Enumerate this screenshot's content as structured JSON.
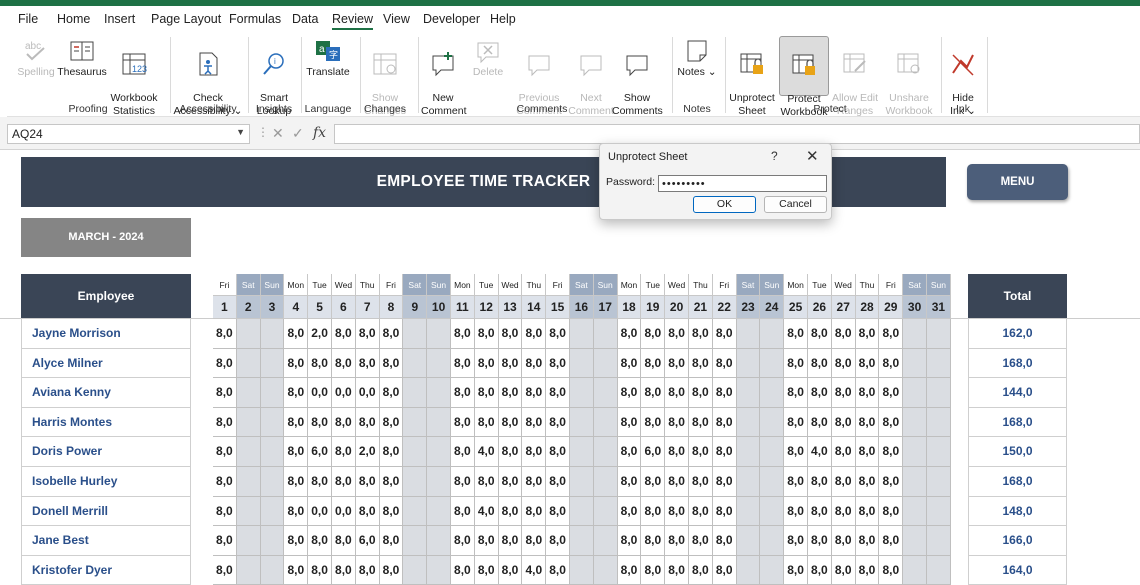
{
  "menu_tabs": [
    "File",
    "Home",
    "Insert",
    "Page Layout",
    "Formulas",
    "Data",
    "Review",
    "View",
    "Developer",
    "Help"
  ],
  "active_tab": "Review",
  "ribbon": {
    "spelling": "Spelling",
    "thesaurus": "Thesaurus",
    "workbook_statistics": "Workbook\nStatistics",
    "proofing": "Proofing",
    "check_accessibility": "Check\nAccessibility ⌄",
    "accessibility": "Accessibility",
    "smart_lookup": "Smart\nLookup",
    "insights": "Insights",
    "translate": "Translate",
    "language": "Language",
    "show_changes": "Show\nChanges",
    "changes": "Changes",
    "new_comment": "New\nComment",
    "delete": "Delete",
    "previous_comment": "Previous\nComment",
    "next_comment": "Next\nComment",
    "show_comments": "Show\nComments",
    "comments": "Comments",
    "notes": "Notes ⌄",
    "notes_group": "Notes",
    "unprotect_sheet": "Unprotect\nSheet",
    "protect_workbook": "Protect\nWorkbook",
    "allow_edit_ranges": "Allow Edit\nRanges",
    "unshare_workbook": "Unshare\nWorkbook",
    "protect": "Protect",
    "hide_ink": "Hide\nInk ⌄",
    "ink": "Ink"
  },
  "formula_bar": {
    "name_box": "AQ24",
    "fx": "fx"
  },
  "sheet": {
    "title": "EMPLOYEE TIME TRACKER",
    "menu_button": "MENU",
    "month": "MARCH - 2024",
    "employee_header": "Employee",
    "total_header": "Total",
    "day_names": [
      "Fri",
      "Sat",
      "Sun",
      "Mon",
      "Tue",
      "Wed",
      "Thu",
      "Fri",
      "Sat",
      "Sun",
      "Mon",
      "Tue",
      "Wed",
      "Thu",
      "Fri",
      "Sat",
      "Sun",
      "Mon",
      "Tue",
      "Wed",
      "Thu",
      "Fri",
      "Sat",
      "Sun",
      "Mon",
      "Tue",
      "Wed",
      "Thu",
      "Fri",
      "Sat",
      "Sun"
    ],
    "day_numbers": [
      "1",
      "2",
      "3",
      "4",
      "5",
      "6",
      "7",
      "8",
      "9",
      "10",
      "11",
      "12",
      "13",
      "14",
      "15",
      "16",
      "17",
      "18",
      "19",
      "20",
      "21",
      "22",
      "23",
      "24",
      "25",
      "26",
      "27",
      "28",
      "29",
      "30",
      "31"
    ],
    "employees": [
      {
        "name": "Jayne Morrison",
        "hours": [
          "8,0",
          "",
          "",
          "8,0",
          "2,0",
          "8,0",
          "8,0",
          "8,0",
          "",
          "",
          "8,0",
          "8,0",
          "8,0",
          "8,0",
          "8,0",
          "",
          "",
          "8,0",
          "8,0",
          "8,0",
          "8,0",
          "8,0",
          "",
          "",
          "8,0",
          "8,0",
          "8,0",
          "8,0",
          "8,0",
          "",
          ""
        ],
        "total": "162,0"
      },
      {
        "name": "Alyce Milner",
        "hours": [
          "8,0",
          "",
          "",
          "8,0",
          "8,0",
          "8,0",
          "8,0",
          "8,0",
          "",
          "",
          "8,0",
          "8,0",
          "8,0",
          "8,0",
          "8,0",
          "",
          "",
          "8,0",
          "8,0",
          "8,0",
          "8,0",
          "8,0",
          "",
          "",
          "8,0",
          "8,0",
          "8,0",
          "8,0",
          "8,0",
          "",
          ""
        ],
        "total": "168,0"
      },
      {
        "name": "Aviana Kenny",
        "hours": [
          "8,0",
          "",
          "",
          "8,0",
          "0,0",
          "0,0",
          "0,0",
          "8,0",
          "",
          "",
          "8,0",
          "8,0",
          "8,0",
          "8,0",
          "8,0",
          "",
          "",
          "8,0",
          "8,0",
          "8,0",
          "8,0",
          "8,0",
          "",
          "",
          "8,0",
          "8,0",
          "8,0",
          "8,0",
          "8,0",
          "",
          ""
        ],
        "total": "144,0"
      },
      {
        "name": "Harris Montes",
        "hours": [
          "8,0",
          "",
          "",
          "8,0",
          "8,0",
          "8,0",
          "8,0",
          "8,0",
          "",
          "",
          "8,0",
          "8,0",
          "8,0",
          "8,0",
          "8,0",
          "",
          "",
          "8,0",
          "8,0",
          "8,0",
          "8,0",
          "8,0",
          "",
          "",
          "8,0",
          "8,0",
          "8,0",
          "8,0",
          "8,0",
          "",
          ""
        ],
        "total": "168,0"
      },
      {
        "name": "Doris Power",
        "hours": [
          "8,0",
          "",
          "",
          "8,0",
          "6,0",
          "8,0",
          "2,0",
          "8,0",
          "",
          "",
          "8,0",
          "4,0",
          "8,0",
          "8,0",
          "8,0",
          "",
          "",
          "8,0",
          "6,0",
          "8,0",
          "8,0",
          "8,0",
          "",
          "",
          "8,0",
          "4,0",
          "8,0",
          "8,0",
          "8,0",
          "",
          ""
        ],
        "total": "150,0"
      },
      {
        "name": "Isobelle Hurley",
        "hours": [
          "8,0",
          "",
          "",
          "8,0",
          "8,0",
          "8,0",
          "8,0",
          "8,0",
          "",
          "",
          "8,0",
          "8,0",
          "8,0",
          "8,0",
          "8,0",
          "",
          "",
          "8,0",
          "8,0",
          "8,0",
          "8,0",
          "8,0",
          "",
          "",
          "8,0",
          "8,0",
          "8,0",
          "8,0",
          "8,0",
          "",
          ""
        ],
        "total": "168,0"
      },
      {
        "name": "Donell Merrill",
        "hours": [
          "8,0",
          "",
          "",
          "8,0",
          "0,0",
          "0,0",
          "8,0",
          "8,0",
          "",
          "",
          "8,0",
          "4,0",
          "8,0",
          "8,0",
          "8,0",
          "",
          "",
          "8,0",
          "8,0",
          "8,0",
          "8,0",
          "8,0",
          "",
          "",
          "8,0",
          "8,0",
          "8,0",
          "8,0",
          "8,0",
          "",
          ""
        ],
        "total": "148,0"
      },
      {
        "name": "Jane Best",
        "hours": [
          "8,0",
          "",
          "",
          "8,0",
          "8,0",
          "8,0",
          "6,0",
          "8,0",
          "",
          "",
          "8,0",
          "8,0",
          "8,0",
          "8,0",
          "8,0",
          "",
          "",
          "8,0",
          "8,0",
          "8,0",
          "8,0",
          "8,0",
          "",
          "",
          "8,0",
          "8,0",
          "8,0",
          "8,0",
          "8,0",
          "",
          ""
        ],
        "total": "166,0"
      },
      {
        "name": "Kristofer Dyer",
        "hours": [
          "8,0",
          "",
          "",
          "8,0",
          "8,0",
          "8,0",
          "8,0",
          "8,0",
          "",
          "",
          "8,0",
          "8,0",
          "8,0",
          "4,0",
          "8,0",
          "",
          "",
          "8,0",
          "8,0",
          "8,0",
          "8,0",
          "8,0",
          "",
          "",
          "8,0",
          "8,0",
          "8,0",
          "8,0",
          "8,0",
          "",
          ""
        ],
        "total": "164,0"
      }
    ]
  },
  "dialog": {
    "title": "Unprotect Sheet",
    "help": "?",
    "close": "✕",
    "password_label": "Password:",
    "password_value": "•••••••••",
    "ok": "OK",
    "cancel": "Cancel"
  }
}
